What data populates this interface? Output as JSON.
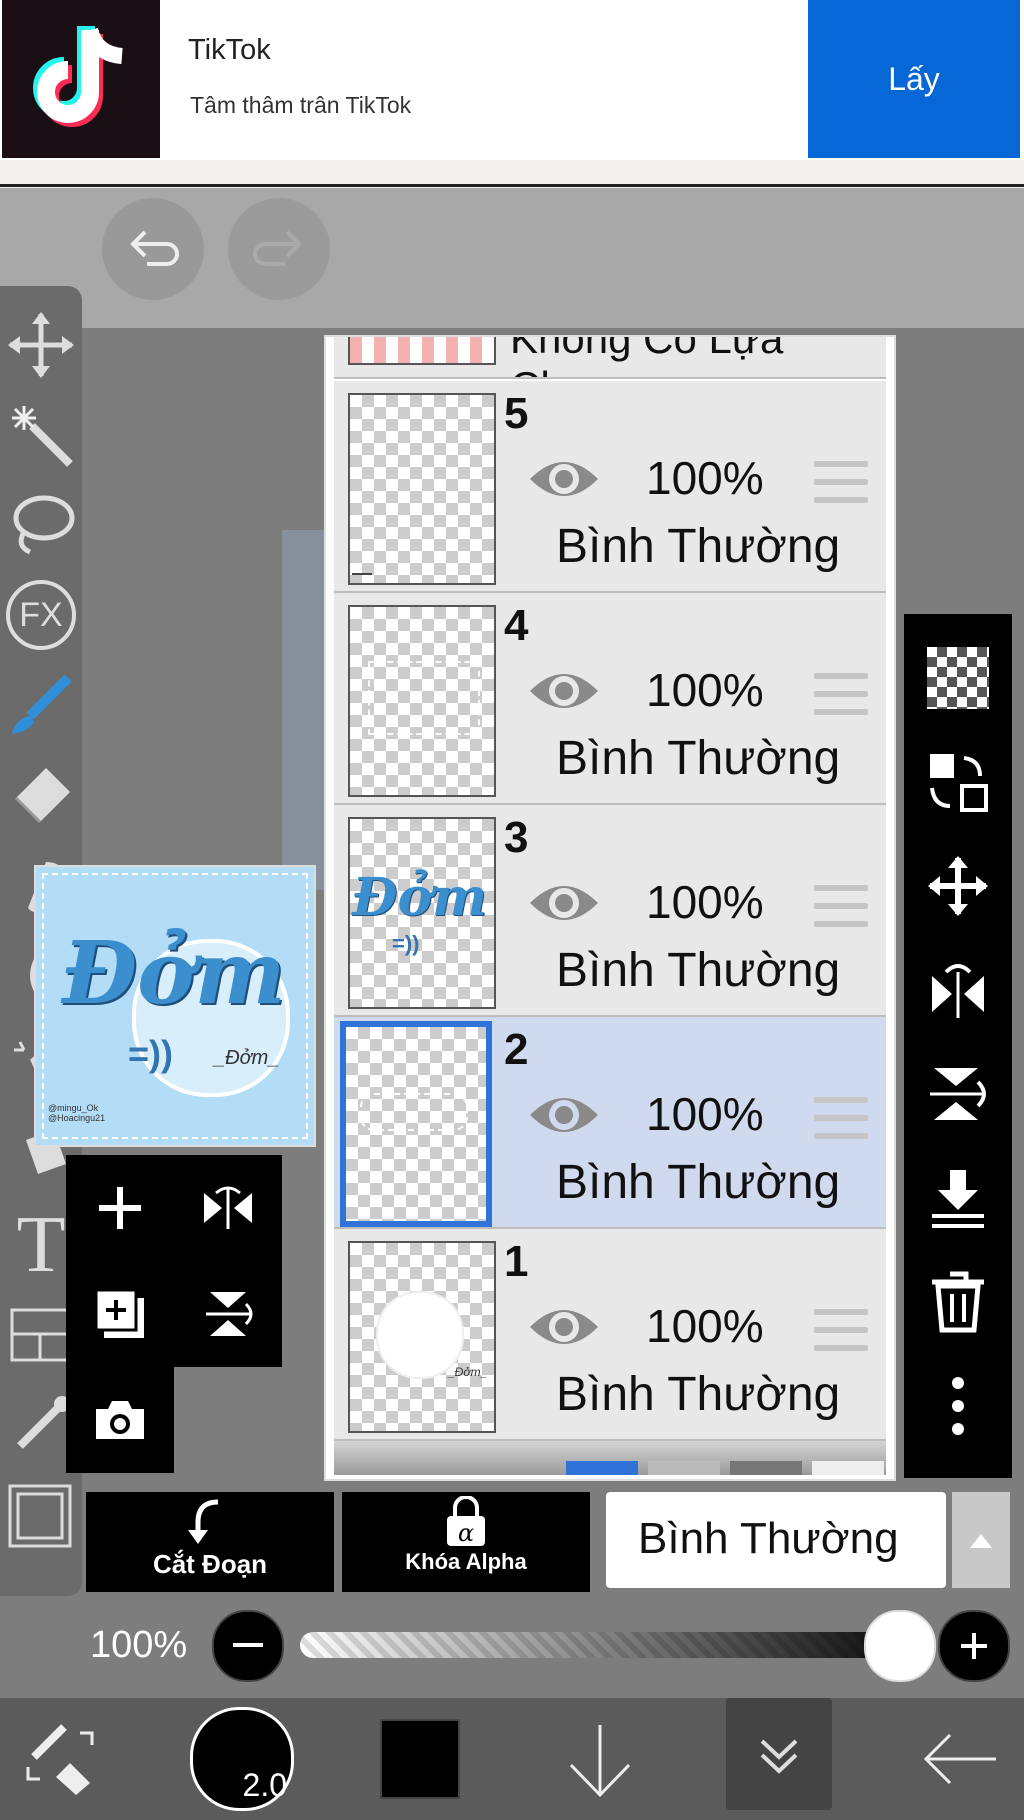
{
  "ad": {
    "title": "TikTok",
    "subtitle": "Tâm thâm trân TikTok",
    "button": "Lấy",
    "icon": "tiktok-logo"
  },
  "top_controls": {
    "undo_icon": "undo-icon",
    "redo_icon": "redo-icon"
  },
  "left_toolbar": {
    "tools": [
      "move-tool-icon",
      "magic-wand-icon",
      "lasso-icon",
      "fx-icon",
      "brush-icon",
      "eraser-icon",
      "smudge-icon",
      "blur-icon",
      "bucket-icon",
      "fill-icon",
      "text-icon",
      "frame-divider-icon",
      "eyedropper-icon",
      "canvas-icon"
    ],
    "fx_label": "FX"
  },
  "preview": {
    "title_text": "Đởm",
    "sub_text": "_Đởm_",
    "smile": "=))",
    "credits": "@mingu_Ok\n@Hoacingu21"
  },
  "quick_panel": {
    "items": [
      "add-layer-icon",
      "flip-horizontal-icon",
      "add-copy-layer-icon",
      "flip-vertical-icon",
      "camera-icon"
    ]
  },
  "layers_panel": {
    "header_partial": "Không Có Lựa Chọn",
    "layers": [
      {
        "number": "5",
        "opacity": "100%",
        "mode": "Bình Thường",
        "selected": false
      },
      {
        "number": "4",
        "opacity": "100%",
        "mode": "Bình Thường",
        "selected": false
      },
      {
        "number": "3",
        "opacity": "100%",
        "mode": "Bình Thường",
        "selected": false
      },
      {
        "number": "2",
        "opacity": "100%",
        "mode": "Bình Thường",
        "selected": true
      },
      {
        "number": "1",
        "opacity": "100%",
        "mode": "Bình Thường",
        "selected": false
      }
    ],
    "layer3_thumb_text": "Đởm",
    "layer1_thumb_text": "_Đởm_"
  },
  "right_toolbar": {
    "tools": [
      "transparency-icon",
      "swap-layer-icon",
      "move-icon",
      "flip-icon",
      "flip-vertical-rotate-icon",
      "merge-down-icon",
      "trash-icon",
      "more-icon"
    ]
  },
  "bottom_controls": {
    "clip_label": "Cắt Đoạn",
    "alpha_label": "Khóa Alpha",
    "blend_mode": "Bình Thường"
  },
  "opacity": {
    "label": "100%",
    "value": 1.0
  },
  "bottom_bar": {
    "brush_size": "2.0",
    "color": "#000000",
    "items": [
      "tool-swap-icon",
      "brush-size",
      "color-swatch",
      "download-icon",
      "layers-collapse-icon",
      "back-arrow-icon"
    ]
  },
  "colors": {
    "accent": "#2f73d8",
    "ad_button": "#0767d6",
    "selected_layer": "#cfdaee"
  }
}
